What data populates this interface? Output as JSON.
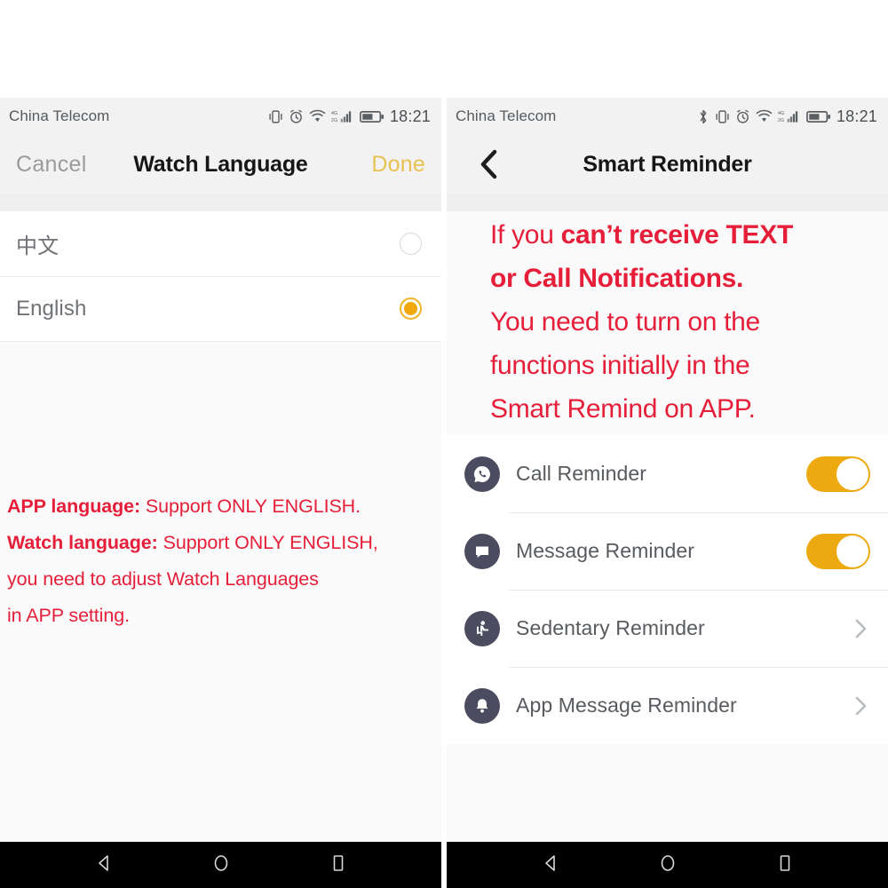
{
  "left_panel": {
    "statusbar": {
      "carrier": "China Telecom",
      "clock": "18:21",
      "icons": [
        "vibrate-icon",
        "alarm-icon",
        "wifi-icon",
        "signal-icon",
        "battery-icon"
      ]
    },
    "navbar": {
      "cancel_label": "Cancel",
      "title": "Watch Language",
      "done_label": "Done",
      "done_color": "#e8c250"
    },
    "languages": [
      {
        "label": "中文",
        "selected": false
      },
      {
        "label": "English",
        "selected": true
      }
    ],
    "note": {
      "line1_bold": "APP language:",
      "line1_rest": " Support ONLY ENGLISH.",
      "line2_bold": "Watch language:",
      "line2_rest": " Support ONLY ENGLISH,",
      "line3": "you need to adjust Watch Languages",
      "line4": "in APP setting.",
      "color": "#e51f39"
    }
  },
  "right_panel": {
    "statusbar": {
      "carrier": "China Telecom",
      "clock": "18:21",
      "icons": [
        "bluetooth-icon",
        "vibrate-icon",
        "alarm-icon",
        "wifi-icon",
        "signal-icon",
        "battery-icon"
      ]
    },
    "navbar": {
      "back_icon": "chevron-left-icon",
      "title": "Smart Reminder"
    },
    "note": {
      "l1_a": "If you ",
      "l1_b": "can’t receive TEXT",
      "l2_b": "or Call Notifications.",
      "l3": "You need to turn on the",
      "l4": "functions initially in the",
      "l5": "Smart Remind on APP.",
      "color": "#e51f39",
      "highlight_color": "#e8a80e"
    },
    "reminders": [
      {
        "label": "Call Reminder",
        "icon": "phone-call-icon",
        "control": "toggle",
        "on": true
      },
      {
        "label": "Message Reminder",
        "icon": "chat-bubble-icon",
        "control": "toggle",
        "on": true
      },
      {
        "label": "Sedentary Reminder",
        "icon": "sitting-person-icon",
        "control": "chevron",
        "on": false
      },
      {
        "label": "App Message Reminder",
        "icon": "bell-icon",
        "control": "chevron",
        "on": false
      }
    ],
    "toggle_color": "#eda910",
    "icon_bg_color": "#4c4c60"
  },
  "android_nav": {
    "back": "back-triangle-icon",
    "home": "home-circle-icon",
    "recents": "recents-square-icon"
  }
}
